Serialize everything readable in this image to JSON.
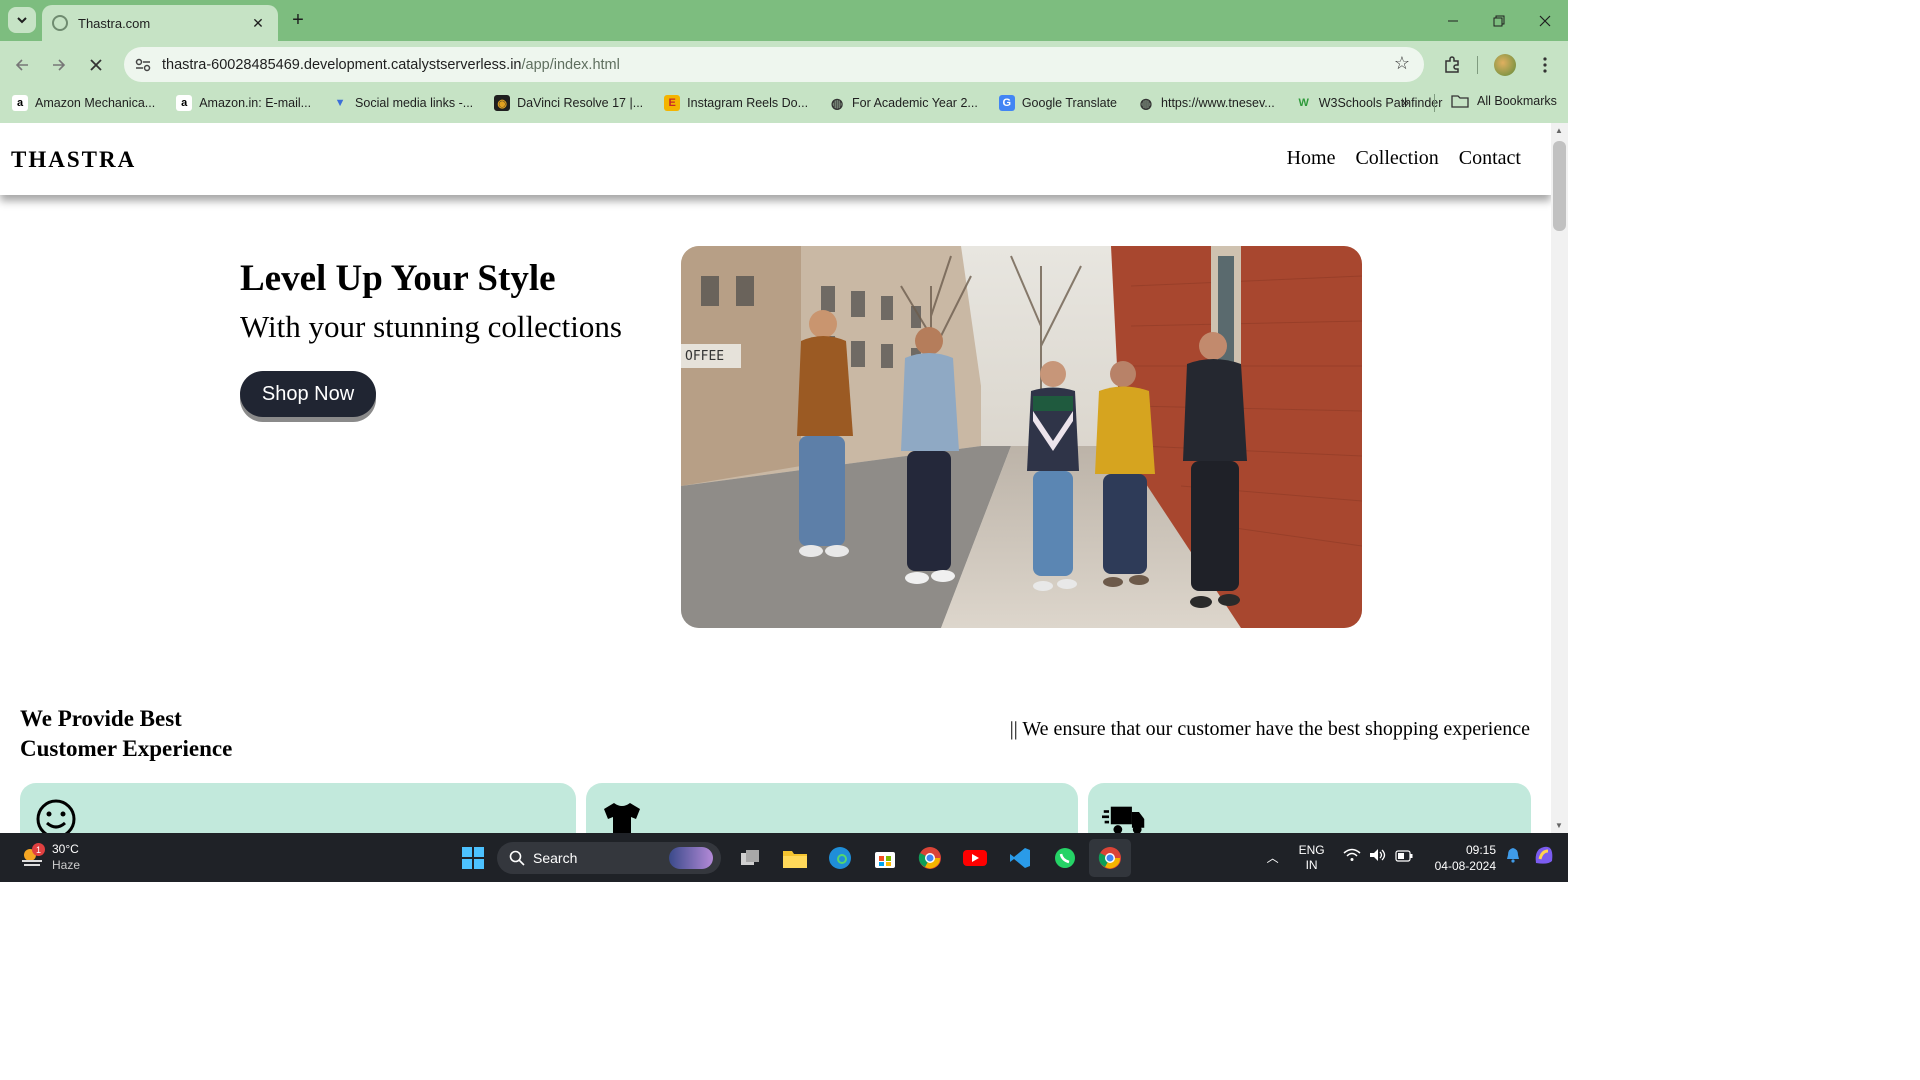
{
  "browser": {
    "tab_title": "Thastra.com",
    "url_host": "thastra-60028485469.development.catalystserverless.in",
    "url_path": "/app/index.html",
    "bookmarks": [
      {
        "label": "Amazon Mechanica...",
        "icon": "amazon-icon"
      },
      {
        "label": "Amazon.in: E-mail...",
        "icon": "amazon-icon"
      },
      {
        "label": "Social media links -...",
        "icon": "vector-logo-icon"
      },
      {
        "label": "DaVinci Resolve 17 |...",
        "icon": "davinci-icon"
      },
      {
        "label": "Instagram Reels Do...",
        "icon": "reels-download-icon"
      },
      {
        "label": "For Academic Year 2...",
        "icon": "globe-icon"
      },
      {
        "label": "Google Translate",
        "icon": "google-translate-icon"
      },
      {
        "label": "https://www.tnesev...",
        "icon": "globe-icon"
      },
      {
        "label": "W3Schools Pathfinder",
        "icon": "w3schools-icon"
      }
    ],
    "all_bookmarks_label": "All Bookmarks",
    "accent_color": "#7dbd7f",
    "toolbar_color": "#c6e3c5"
  },
  "site": {
    "logo": "THASTRA",
    "nav": [
      "Home",
      "Collection",
      "Contact"
    ],
    "hero": {
      "title": "Level Up Your Style",
      "subtitle": "With your stunning collections",
      "cta": "Shop Now",
      "image_alt": "Group of friends walking along a city sidewalk"
    },
    "experience": {
      "title": "We Provide Best Customer Experience",
      "text": "|| We ensure that our customer have the best shopping experience"
    },
    "cards": [
      {
        "icon": "smiley-icon"
      },
      {
        "icon": "tshirt-icon"
      },
      {
        "icon": "delivery-truck-icon"
      }
    ],
    "card_color": "#c2e9dc",
    "button_color": "#202532"
  },
  "taskbar": {
    "weather_temp": "30°C",
    "weather_desc": "Haze",
    "weather_badge": "1",
    "search_label": "Search",
    "lang_top": "ENG",
    "lang_bottom": "IN",
    "time": "09:15",
    "date": "04-08-2024"
  }
}
